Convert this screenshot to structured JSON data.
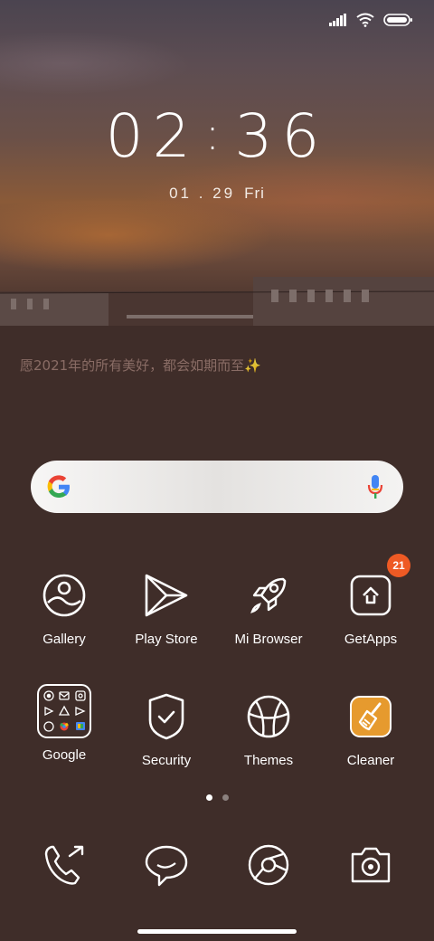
{
  "status": {
    "signal": "signal-icon",
    "wifi": "wifi-icon",
    "battery": "battery-icon"
  },
  "clock": {
    "hours": "02",
    "minutes": "36"
  },
  "date": {
    "text": "01 . 29",
    "weekday": "Fri"
  },
  "signature": "愿2021年的所有美好，都会如期而至✨",
  "search": {
    "logo": "google-g-icon",
    "mic": "mic-icon"
  },
  "apps": [
    {
      "label": "Gallery",
      "icon": "gallery-icon"
    },
    {
      "label": "Play Store",
      "icon": "play-store-icon"
    },
    {
      "label": "Mi Browser",
      "icon": "rocket-icon"
    },
    {
      "label": "GetApps",
      "icon": "getapps-icon",
      "badge": "21"
    },
    {
      "label": "Google",
      "icon": "google-folder-icon"
    },
    {
      "label": "Security",
      "icon": "shield-check-icon"
    },
    {
      "label": "Themes",
      "icon": "themes-icon"
    },
    {
      "label": "Cleaner",
      "icon": "broom-icon"
    }
  ],
  "page_indicator": {
    "count": 2,
    "active": 1
  },
  "dock": [
    {
      "icon": "phone-icon"
    },
    {
      "icon": "message-icon"
    },
    {
      "icon": "browser-icon"
    },
    {
      "icon": "camera-icon"
    }
  ],
  "colors": {
    "background": "#3f2d29",
    "badge": "#ee5a24",
    "cleaner": "#e69a2e",
    "text": "#ffffff"
  }
}
